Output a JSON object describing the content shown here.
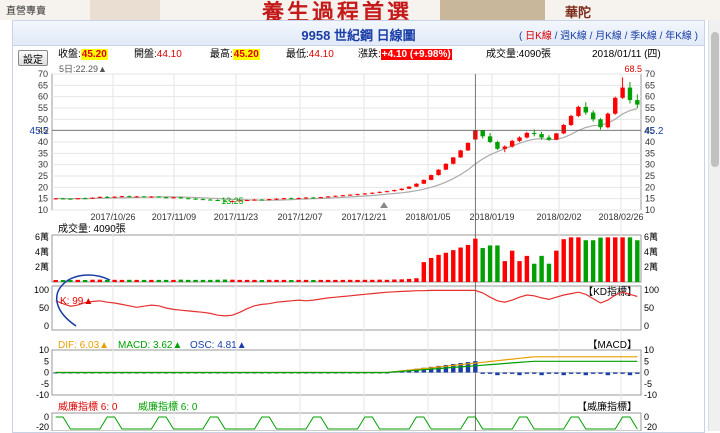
{
  "banner": {
    "shop": "直營專賣",
    "slogan": "養生過程首選",
    "brand": "華陀"
  },
  "header": {
    "title": "9958 世紀鋼  日線圖",
    "links": [
      "日K線",
      "週K線",
      "月K線",
      "季K線",
      "年K線"
    ]
  },
  "toolbar": {
    "settings_label": "設定"
  },
  "quote": {
    "close_label": "收盤:",
    "close": "45.20",
    "open_label": "開盤:",
    "open": "44.10",
    "high_label": "最高:",
    "high": "45.20",
    "low_label": "最低:",
    "low": "44.10",
    "change_label": "漲跌:",
    "change": "+4.10 (+9.98%)",
    "volume_label": "成交量:",
    "volume": "4090張",
    "date": "2018/01/11 (四)",
    "ma5": "5日:22.29▲"
  },
  "chart_data": {
    "type": "candlestick",
    "dates": [
      "2017/10/26",
      "2017/11/09",
      "2017/11/23",
      "2017/12/07",
      "2017/12/21",
      "2018/01/05",
      "2018/01/19",
      "2018/02/02",
      "2018/02/26"
    ],
    "price_axis": {
      "ticks": [
        10,
        15,
        20,
        25,
        30,
        35,
        40,
        45,
        50,
        55,
        60,
        65,
        70
      ],
      "current": "45.2",
      "high_mark": "68.5",
      "low_mark": "13.25"
    },
    "candles": [
      [
        15,
        15.3,
        14.7,
        15.1
      ],
      [
        15.1,
        15.4,
        14.8,
        15.0
      ],
      [
        15.0,
        15.2,
        14.6,
        14.9
      ],
      [
        14.9,
        15.3,
        14.7,
        15.2
      ],
      [
        15.2,
        15.5,
        14.9,
        15.0
      ],
      [
        15.0,
        15.6,
        14.9,
        15.4
      ],
      [
        15.4,
        16,
        15.2,
        15.8
      ],
      [
        15.8,
        16.2,
        15.4,
        15.6
      ],
      [
        15.6,
        16,
        15.3,
        15.9
      ],
      [
        15.9,
        16.3,
        15.6,
        16.1
      ],
      [
        16.1,
        16.4,
        15.7,
        15.8
      ],
      [
        15.8,
        16.2,
        15.5,
        16.0
      ],
      [
        16.0,
        16.2,
        15.6,
        15.7
      ],
      [
        15.7,
        16.1,
        15.4,
        15.9
      ],
      [
        15.9,
        16.1,
        15.5,
        15.6
      ],
      [
        15.6,
        15.9,
        15.2,
        15.4
      ],
      [
        15.4,
        15.8,
        15.1,
        15.6
      ],
      [
        15.6,
        15.8,
        15.0,
        15.2
      ],
      [
        15.2,
        15.5,
        14.8,
        15.0
      ],
      [
        15.0,
        15.3,
        14.6,
        14.8
      ],
      [
        14.8,
        15.1,
        14.4,
        14.6
      ],
      [
        14.6,
        14.9,
        14.2,
        14.4
      ],
      [
        14.4,
        14.7,
        13.9,
        14.1
      ],
      [
        14.1,
        14.5,
        13.5,
        13.8
      ],
      [
        13.8,
        14.2,
        13.25,
        14.0
      ],
      [
        14.0,
        14.4,
        13.7,
        14.2
      ],
      [
        14.2,
        14.6,
        13.9,
        14.4
      ],
      [
        14.4,
        14.8,
        14.1,
        14.6
      ],
      [
        14.6,
        14.9,
        14.3,
        14.5
      ],
      [
        14.5,
        14.9,
        14.2,
        14.8
      ],
      [
        14.8,
        15.2,
        14.5,
        15.0
      ],
      [
        15.0,
        15.4,
        14.7,
        15.2
      ],
      [
        15.2,
        15.5,
        14.9,
        15.1
      ],
      [
        15.1,
        15.5,
        14.8,
        15.3
      ],
      [
        15.3,
        15.7,
        15.0,
        15.5
      ],
      [
        15.5,
        15.8,
        15.1,
        15.4
      ],
      [
        15.4,
        15.8,
        15.2,
        15.7
      ],
      [
        15.7,
        16.1,
        15.5,
        16.0
      ],
      [
        16.0,
        16.4,
        15.8,
        16.3
      ],
      [
        16.3,
        16.7,
        16.0,
        16.5
      ],
      [
        16.5,
        16.9,
        16.2,
        16.8
      ],
      [
        16.8,
        17.2,
        16.5,
        17.0
      ],
      [
        17.0,
        17.5,
        16.8,
        17.3
      ],
      [
        17.3,
        17.8,
        17.1,
        17.6
      ],
      [
        17.6,
        18.2,
        17.4,
        18.0
      ],
      [
        18.0,
        18.5,
        17.8,
        18.3
      ],
      [
        18.3,
        19.0,
        18.1,
        18.8
      ],
      [
        18.8,
        19.6,
        18.6,
        19.4
      ],
      [
        19.4,
        20.5,
        19.2,
        20.3
      ],
      [
        20.3,
        21.8,
        20.1,
        21.6
      ],
      [
        21.6,
        23.5,
        21.4,
        23.3
      ],
      [
        23.3,
        25.6,
        23.1,
        25.4
      ],
      [
        25.4,
        28.0,
        25.2,
        27.8
      ],
      [
        27.8,
        30.6,
        27.6,
        30.4
      ],
      [
        30.4,
        33.4,
        30.1,
        33.2
      ],
      [
        33.2,
        36.5,
        33.0,
        36.3
      ],
      [
        36.3,
        39.8,
        36.0,
        39.6
      ],
      [
        41.1,
        45.2,
        41.0,
        45.2
      ],
      [
        45.2,
        45.3,
        41.5,
        42.5
      ],
      [
        42.5,
        44.0,
        39.5,
        40.0
      ],
      [
        40.0,
        40.5,
        36.5,
        37.0
      ],
      [
        37.0,
        38.5,
        35.5,
        38.0
      ],
      [
        38.0,
        41.0,
        37.5,
        40.5
      ],
      [
        40.5,
        42.5,
        40.0,
        42.0
      ],
      [
        42.0,
        44.5,
        41.5,
        44.0
      ],
      [
        44.0,
        45.5,
        42.5,
        43.5
      ],
      [
        43.5,
        44.5,
        41.0,
        42.0
      ],
      [
        42.0,
        43.0,
        40.5,
        41.0
      ],
      [
        41.0,
        44.0,
        40.8,
        43.8
      ],
      [
        43.8,
        48.0,
        43.5,
        47.5
      ],
      [
        47.5,
        52.0,
        47.0,
        51.5
      ],
      [
        51.5,
        56.0,
        51.0,
        55.5
      ],
      [
        55.5,
        57.5,
        52.0,
        53.0
      ],
      [
        53.0,
        54.0,
        49.0,
        50.0
      ],
      [
        50.0,
        50.5,
        45.5,
        46.5
      ],
      [
        46.5,
        53.0,
        46.0,
        52.5
      ],
      [
        52.5,
        60.0,
        52.0,
        59.5
      ],
      [
        59.5,
        68.5,
        59.0,
        64.0
      ],
      [
        64.0,
        66.5,
        57.0,
        58.5
      ],
      [
        58.5,
        61.0,
        55.0,
        56.5
      ]
    ],
    "volume_axis": {
      "ticks": [
        "6萬",
        "4萬",
        "2萬"
      ],
      "current": "4090張"
    },
    "kd": {
      "label": "K: 99▲",
      "title": "【KD指標】",
      "ticks": [
        100,
        50,
        0
      ]
    },
    "macd": {
      "dif_label": "DIF: 6.03▲",
      "macd_label": "MACD: 3.62▲",
      "osc_label": "OSC: 4.81▲",
      "title": "【MACD】",
      "ticks": [
        10,
        5,
        0,
        -5,
        -10
      ]
    },
    "wwl": {
      "label1": "威廉指標 6: 0",
      "label2": "威廉指標 6: 0",
      "title": "【威廉指標】",
      "ticks": [
        0,
        -20
      ]
    }
  },
  "colors": {
    "up": "#ff0000",
    "down": "#00a000",
    "ma": "#aaaaaa",
    "link": "#1a3ea8",
    "dif": "#e8a000",
    "macd": "#00a000",
    "osc": "#1a3ea8"
  }
}
